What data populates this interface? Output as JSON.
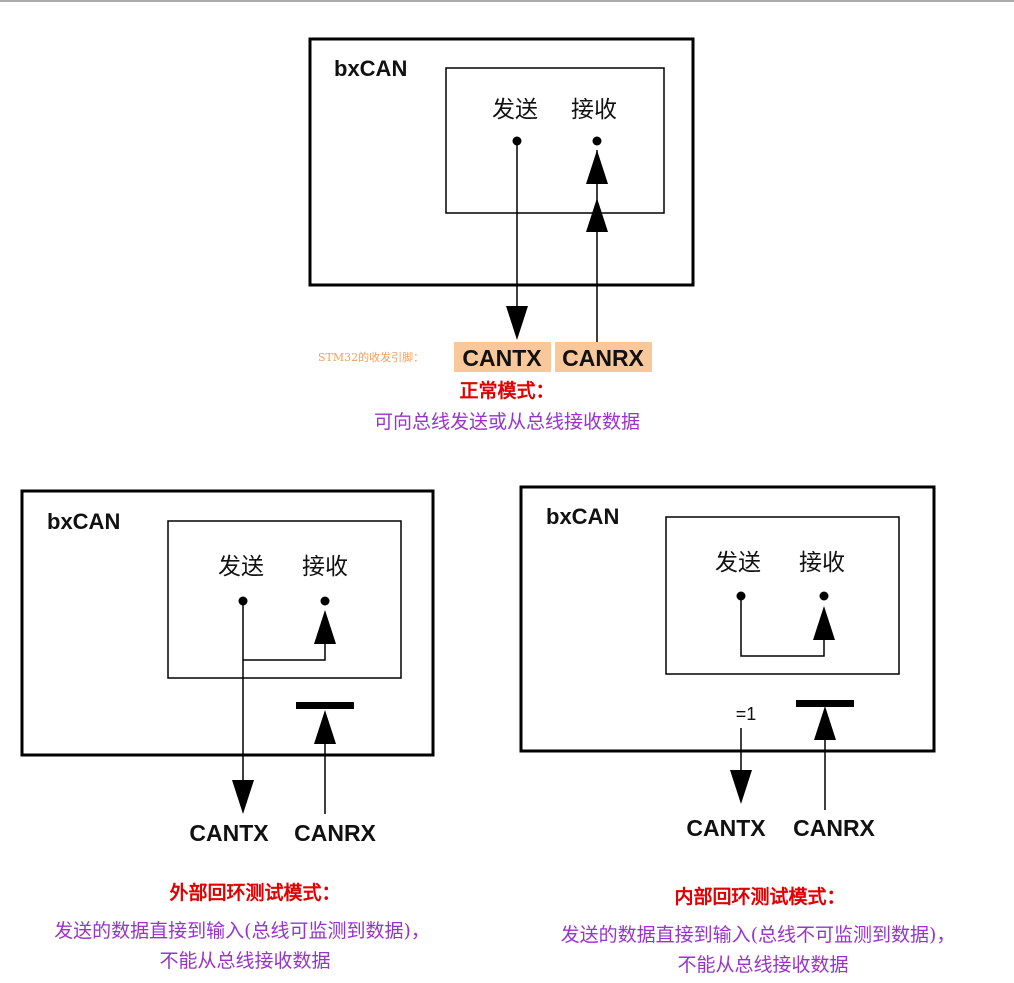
{
  "normal": {
    "block_label": "bxCAN",
    "tx_label": "发送",
    "rx_label": "接收",
    "pin_note": "STM32的收发引脚：",
    "pin_tx": "CANTX",
    "pin_rx": "CANRX",
    "caption_title": "正常模式：",
    "caption_desc": "可向总线发送或从总线接收数据"
  },
  "loopback": {
    "block_label": "bxCAN",
    "tx_label": "发送",
    "rx_label": "接收",
    "pin_tx": "CANTX",
    "pin_rx": "CANRX",
    "caption_title": "外部回环测试模式：",
    "caption_line1": "发送的数据直接到输入(总线可监测到数据)，",
    "caption_line2": "不能从总线接收数据"
  },
  "silent_loopback": {
    "block_label": "bxCAN",
    "tx_label": "发送",
    "rx_label": "接收",
    "eq_label": "=1",
    "pin_tx": "CANTX",
    "pin_rx": "CANRX",
    "caption_title": "内部回环测试模式：",
    "caption_line1": "发送的数据直接到输入(总线不可监测到数据)，",
    "caption_line2": "不能从总线接收数据"
  },
  "colors": {
    "pin_highlight": "#f8c89a",
    "caption_title": "#e00000",
    "caption_desc": "#9933cc"
  }
}
